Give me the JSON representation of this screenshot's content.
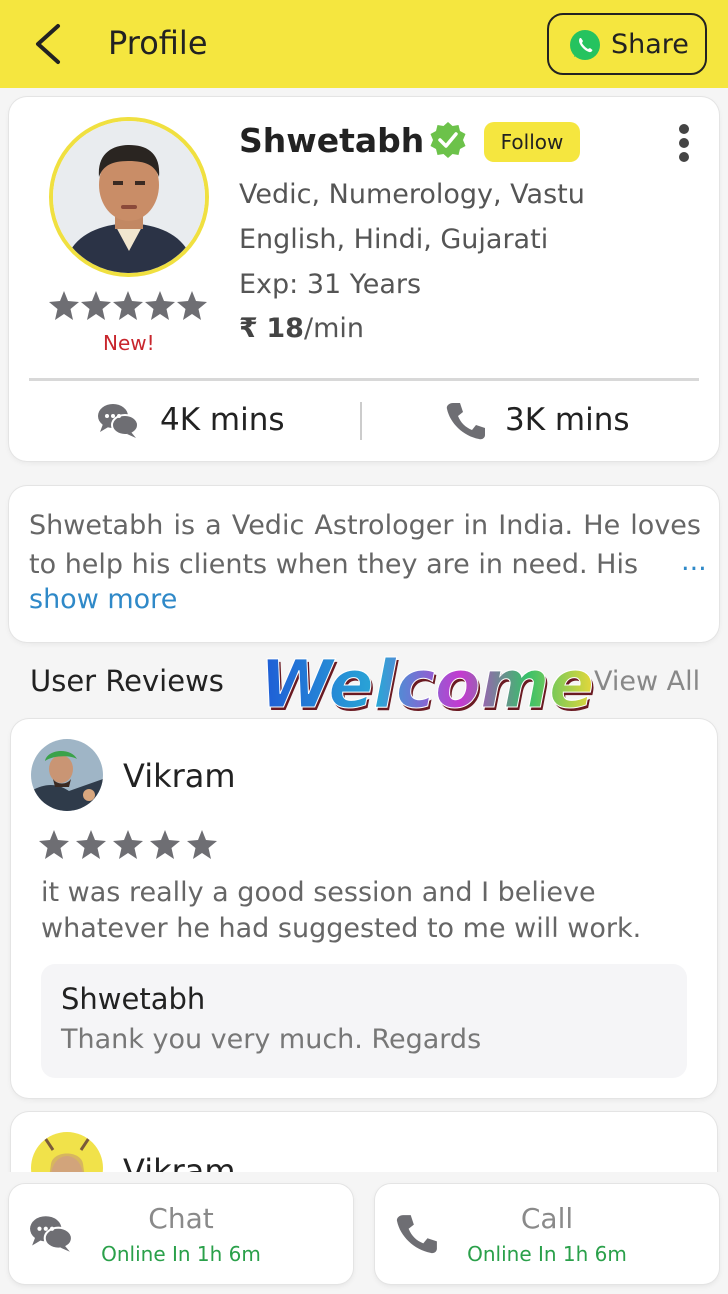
{
  "header": {
    "title": "Profile",
    "share_label": "Share",
    "background": "#f5e63f"
  },
  "profile": {
    "name": "Shwetabh",
    "follow_label": "Follow",
    "specialties": "Vedic, Numerology, Vastu",
    "languages": "English, Hindi, Gujarati",
    "experience": "Exp: 31 Years",
    "price_symbol": "₹",
    "price": "18",
    "price_unit": "/min",
    "rating_stars": 5,
    "rating_badge": "New!",
    "chat_minutes": "4K mins",
    "call_minutes": "3K mins"
  },
  "bio": {
    "text": "Shwetabh is a Vedic Astrologer in India. He loves to help his clients when they are in need. His",
    "ellipsis": "...",
    "show_more": "show more"
  },
  "reviews": {
    "title": "User Reviews",
    "view_all": "View All",
    "overlay_text": "Welcome",
    "items": [
      {
        "name": "Vikram",
        "stars": 5,
        "text": "it was really a good session and I believe whatever he had suggested to me will work.",
        "reply_name": "Shwetabh",
        "reply_text": "Thank you very much. Regards"
      },
      {
        "name": "Vikram"
      }
    ]
  },
  "actions": {
    "chat_label": "Chat",
    "chat_status": "Online In 1h 6m",
    "call_label": "Call",
    "call_status": "Online In 1h 6m"
  }
}
